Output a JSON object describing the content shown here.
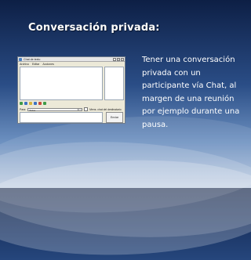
{
  "slide": {
    "title": "Conversación privada:",
    "body": "Tener una conversación privada con un participante vía Chat, al margen de una reunión por ejemplo durante una pausa."
  },
  "chat_window": {
    "title": "Chat de texto",
    "menu": [
      "Archivo",
      "Editar",
      "Acciones"
    ],
    "to_label": "Para:",
    "to_value": "Todos",
    "private_option": "Mens. chat del destinatario",
    "send_label": "Enviar",
    "window_buttons": [
      "minimize-icon",
      "maximize-icon",
      "close-icon"
    ]
  },
  "colors": {
    "background_top": "#0d1f45",
    "background_bottom": "#b8c8df",
    "text": "#ffffff"
  }
}
